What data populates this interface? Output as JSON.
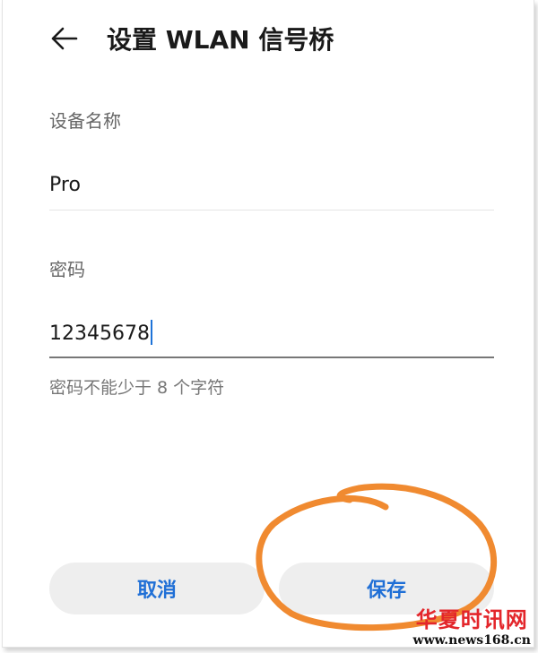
{
  "header": {
    "title": "设置 WLAN 信号桥",
    "back_icon": "arrow-left-icon"
  },
  "form": {
    "device_name_label": "设备名称",
    "device_name_value": "Pro",
    "password_label": "密码",
    "password_value": "12345678",
    "password_hint": "密码不能少于 8 个字符"
  },
  "actions": {
    "cancel_label": "取消",
    "save_label": "保存"
  },
  "watermark": {
    "title": "华夏时讯网",
    "url": "www.news168.cn"
  },
  "colors": {
    "accent": "#1f6fd6",
    "annotation": "#f08a30",
    "watermark": "#e3262b"
  }
}
